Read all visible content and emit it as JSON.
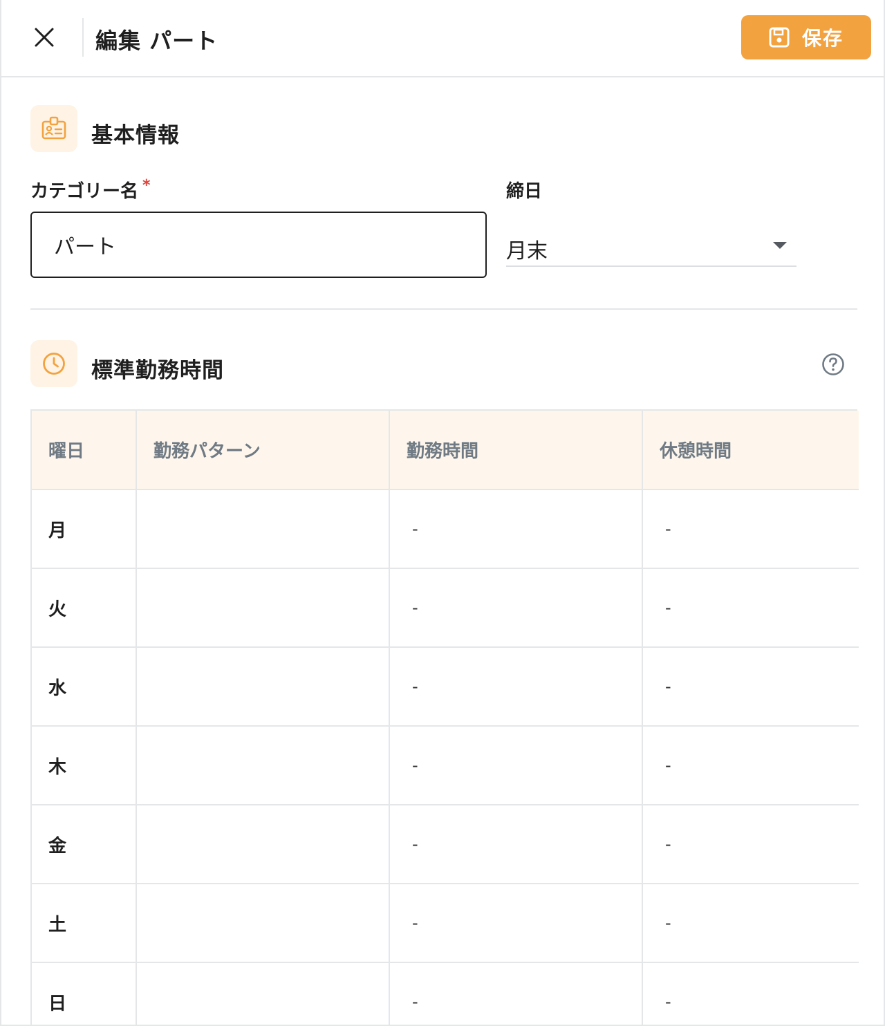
{
  "header": {
    "title": "編集 パート",
    "save_label": "保存"
  },
  "basic_info": {
    "title": "基本情報",
    "category_label": "カテゴリー名",
    "required_mark": "*",
    "category_value": "パート",
    "closing_label": "締日",
    "closing_value": "月末"
  },
  "standard_hours": {
    "title": "標準勤務時間",
    "columns": [
      "曜日",
      "勤務パターン",
      "勤務時間",
      "休憩時間"
    ],
    "rows": [
      {
        "day": "月",
        "pattern": "",
        "work": "-",
        "break": "-"
      },
      {
        "day": "火",
        "pattern": "",
        "work": "-",
        "break": "-"
      },
      {
        "day": "水",
        "pattern": "",
        "work": "-",
        "break": "-"
      },
      {
        "day": "木",
        "pattern": "",
        "work": "-",
        "break": "-"
      },
      {
        "day": "金",
        "pattern": "",
        "work": "-",
        "break": "-"
      },
      {
        "day": "土",
        "pattern": "",
        "work": "-",
        "break": "-"
      },
      {
        "day": "日",
        "pattern": "",
        "work": "-",
        "break": "-"
      }
    ]
  },
  "colors": {
    "accent": "#f2a23f",
    "icon_bg": "#fef3e4",
    "table_header_bg": "#fef6ec",
    "required": "#e0443c"
  },
  "icons": {
    "close": "close-icon",
    "save": "floppy-disk-icon",
    "basic_info": "id-badge-icon",
    "standard_hours": "clock-icon",
    "help": "question-circle-icon",
    "select": "caret-down-icon"
  }
}
